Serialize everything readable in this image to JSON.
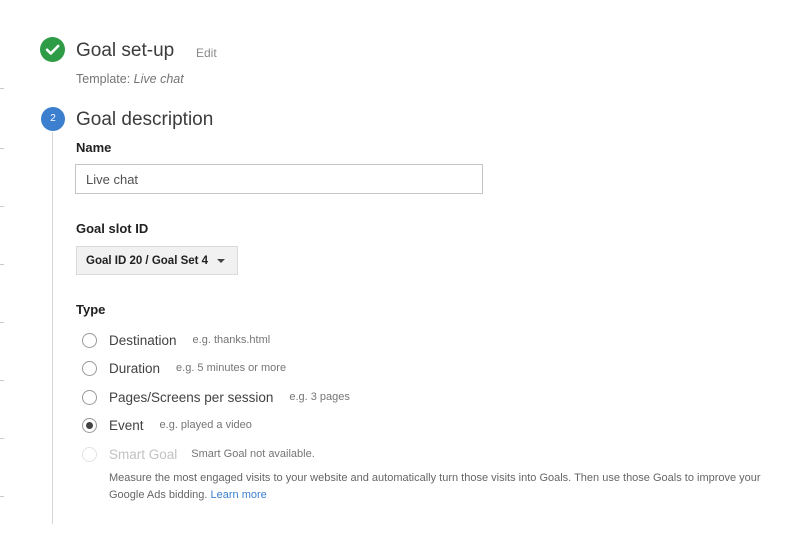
{
  "setup": {
    "title": "Goal set-up",
    "edit_label": "Edit",
    "template_prefix": "Template: ",
    "template_name": "Live chat"
  },
  "description": {
    "step_number": "2",
    "title": "Goal description",
    "name_label": "Name",
    "name_value": "Live chat",
    "slot_label": "Goal slot ID",
    "slot_value": "Goal ID 20 / Goal Set 4",
    "type_label": "Type"
  },
  "types": [
    {
      "label": "Destination",
      "hint": "e.g. thanks.html",
      "selected": false,
      "disabled": false
    },
    {
      "label": "Duration",
      "hint": "e.g. 5 minutes or more",
      "selected": false,
      "disabled": false
    },
    {
      "label": "Pages/Screens per session",
      "hint": "e.g. 3 pages",
      "selected": false,
      "disabled": false
    },
    {
      "label": "Event",
      "hint": "e.g. played a video",
      "selected": true,
      "disabled": false
    },
    {
      "label": "Smart Goal",
      "hint": "Smart Goal not available.",
      "selected": false,
      "disabled": true
    }
  ],
  "smart_goal": {
    "description": "Measure the most engaged visits to your website and automatically turn those visits into Goals. Then use those Goals to improve your Google Ads bidding.",
    "learn_more": "Learn more"
  },
  "colors": {
    "check_green": "#2e9b46",
    "step_blue": "#3c7fcf",
    "link_blue": "#3c7fcf"
  }
}
